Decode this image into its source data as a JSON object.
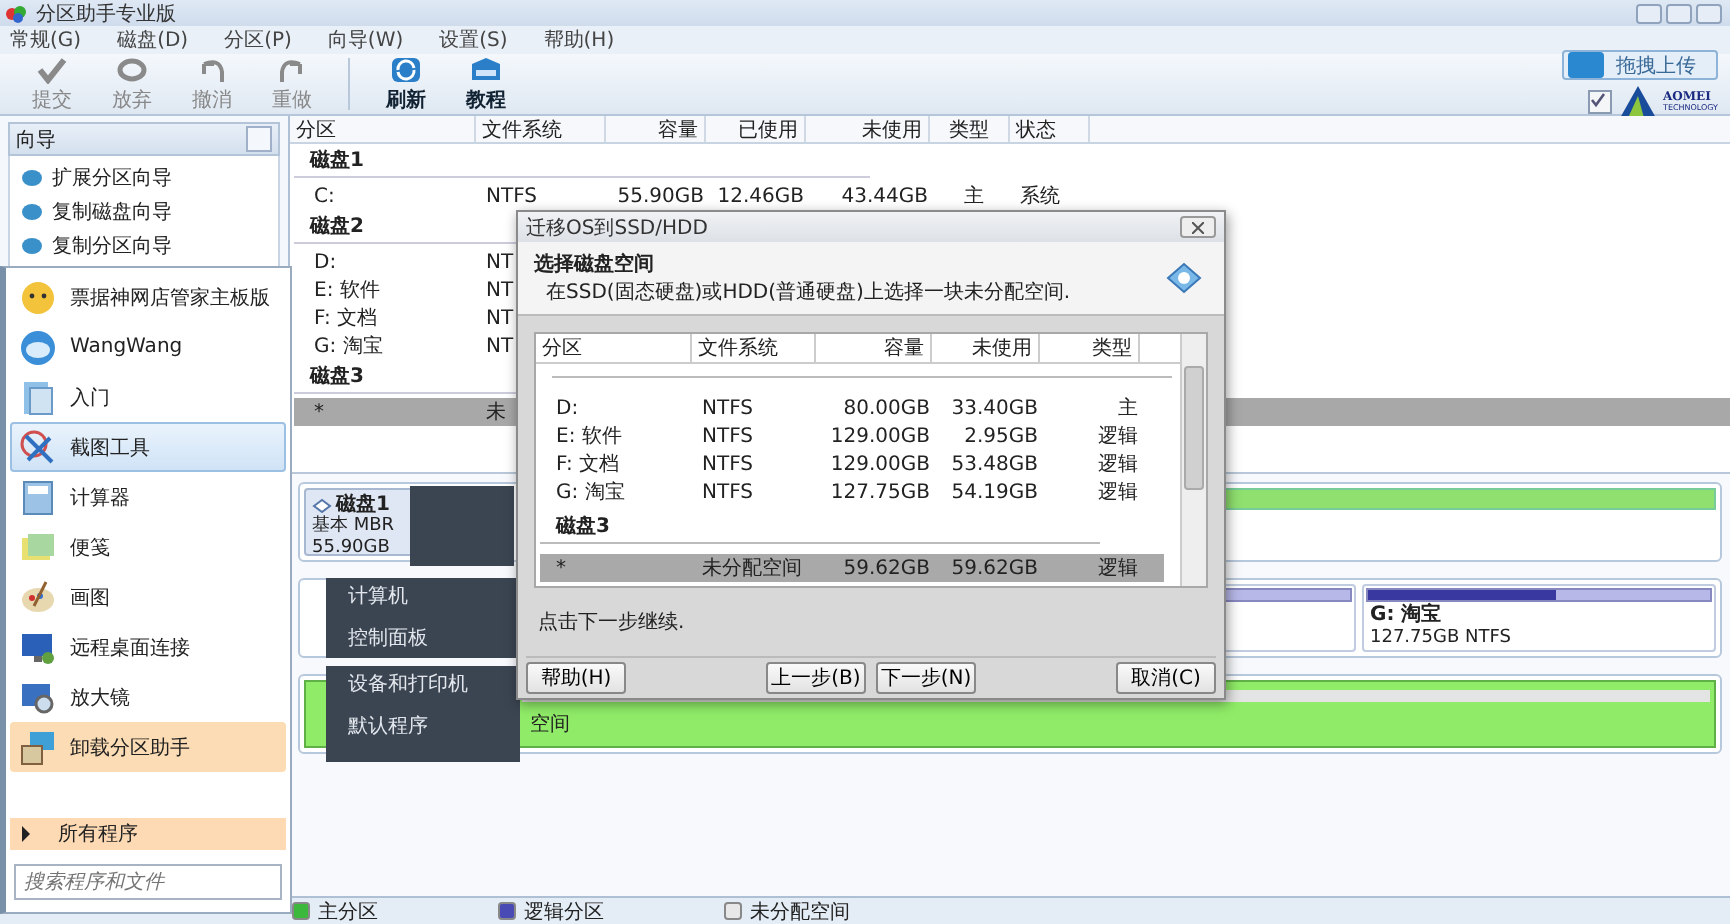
{
  "window": {
    "title": "分区助手专业版"
  },
  "menu": [
    "常规(G)",
    "磁盘(D)",
    "分区(P)",
    "向导(W)",
    "设置(S)",
    "帮助(H)"
  ],
  "toolbar": [
    {
      "label": "提交",
      "kind": "check",
      "disabled": true
    },
    {
      "label": "放弃",
      "kind": "discard",
      "disabled": true
    },
    {
      "label": "撤消",
      "kind": "undo",
      "disabled": true
    },
    {
      "label": "重做",
      "kind": "redo",
      "disabled": true
    },
    {
      "label": "刷新",
      "kind": "refresh",
      "disabled": false
    },
    {
      "label": "教程",
      "kind": "book",
      "disabled": false
    }
  ],
  "upload_button": "拖拽上传",
  "sync_checkbox": {
    "checked": true
  },
  "logo": {
    "name": "AOMEI",
    "sub": "TECHNOLOGY"
  },
  "wizard_panel": {
    "title": "向导",
    "items": [
      "扩展分区向导",
      "复制磁盘向导",
      "复制分区向导"
    ]
  },
  "partition_table": {
    "columns": [
      "分区",
      "文件系统",
      "容量",
      "已使用",
      "未使用",
      "类型",
      "状态"
    ],
    "groups": [
      {
        "disk": "磁盘1",
        "rows": [
          {
            "cells": [
              "C:",
              "NTFS",
              "55.90GB",
              "12.46GB",
              "43.44GB",
              "主",
              "系统"
            ],
            "selected": false
          }
        ]
      },
      {
        "disk": "磁盘2",
        "rows": [
          {
            "cells": [
              "D:",
              "NT"
            ],
            "selected": false
          },
          {
            "cells": [
              "E: 软件",
              "NT"
            ],
            "selected": false
          },
          {
            "cells": [
              "F: 文档",
              "NT"
            ],
            "selected": false
          },
          {
            "cells": [
              "G: 淘宝",
              "NT"
            ],
            "selected": false
          }
        ]
      },
      {
        "disk": "磁盘3",
        "rows": [
          {
            "cells": [
              "*",
              "未"
            ],
            "selected": true
          }
        ]
      }
    ]
  },
  "disk_map": {
    "disk": {
      "name": "磁盘1",
      "type": "基本 MBR",
      "size": "55.90GB"
    },
    "partition": {
      "label": "G: 淘宝",
      "detail": "127.75GB NTFS",
      "level": 0.55
    },
    "unallocated_label": "空间"
  },
  "start_menu": {
    "items": [
      {
        "label": "票据神网店管家主板版",
        "kind": "mascot",
        "selected": false
      },
      {
        "label": "WangWang",
        "kind": "chat",
        "selected": false
      },
      {
        "label": "入门",
        "kind": "doc",
        "selected": false
      },
      {
        "label": "截图工具",
        "kind": "scissors",
        "selected": true
      },
      {
        "label": "计算器",
        "kind": "calculator",
        "selected": false
      },
      {
        "label": "便笺",
        "kind": "note",
        "selected": false
      },
      {
        "label": "画图",
        "kind": "palette",
        "selected": false
      },
      {
        "label": "远程桌面连接",
        "kind": "monitor",
        "selected": false
      },
      {
        "label": "放大镜",
        "kind": "magnifier",
        "selected": false
      },
      {
        "label": "卸载分区助手",
        "kind": "installer",
        "selected": false
      }
    ],
    "all_programs": "所有程序",
    "search_placeholder": "搜索程序和文件",
    "links": [
      [
        "计算机",
        "控制面板"
      ],
      [
        "设备和打印机",
        "默认程序"
      ]
    ]
  },
  "dialog": {
    "title": "迁移OS到SSD/HDD",
    "heading": "选择磁盘空间",
    "subheading": "在SSD(固态硬盘)或HDD(普通硬盘)上选择一块未分配空间.",
    "columns": [
      "分区",
      "文件系统",
      "容量",
      "未使用",
      "类型"
    ],
    "rows": [
      {
        "kind": "row",
        "cells": [
          "D:",
          "NTFS",
          "80.00GB",
          "33.40GB",
          "主"
        ],
        "selected": false
      },
      {
        "kind": "row",
        "cells": [
          "E: 软件",
          "NTFS",
          "129.00GB",
          "2.95GB",
          "逻辑"
        ],
        "selected": false
      },
      {
        "kind": "row",
        "cells": [
          "F: 文档",
          "NTFS",
          "129.00GB",
          "53.48GB",
          "逻辑"
        ],
        "selected": false
      },
      {
        "kind": "row",
        "cells": [
          "G: 淘宝",
          "NTFS",
          "127.75GB",
          "54.19GB",
          "逻辑"
        ],
        "selected": false
      },
      {
        "kind": "group",
        "cells": [
          "磁盘3"
        ]
      },
      {
        "kind": "row",
        "cells": [
          "*",
          "未分配空间",
          "59.62GB",
          "59.62GB",
          "逻辑"
        ],
        "selected": true
      }
    ],
    "hint": "点击下一步继续.",
    "buttons": [
      "帮助(H)",
      "上一步(B)",
      "下一步(N)",
      "取消(C)"
    ]
  },
  "legend": [
    {
      "label": "主分区",
      "color": "#3cb83c"
    },
    {
      "label": "逻辑分区",
      "color": "#4a4ab4"
    },
    {
      "label": "未分配空间",
      "color": "#e8e8e8"
    }
  ]
}
